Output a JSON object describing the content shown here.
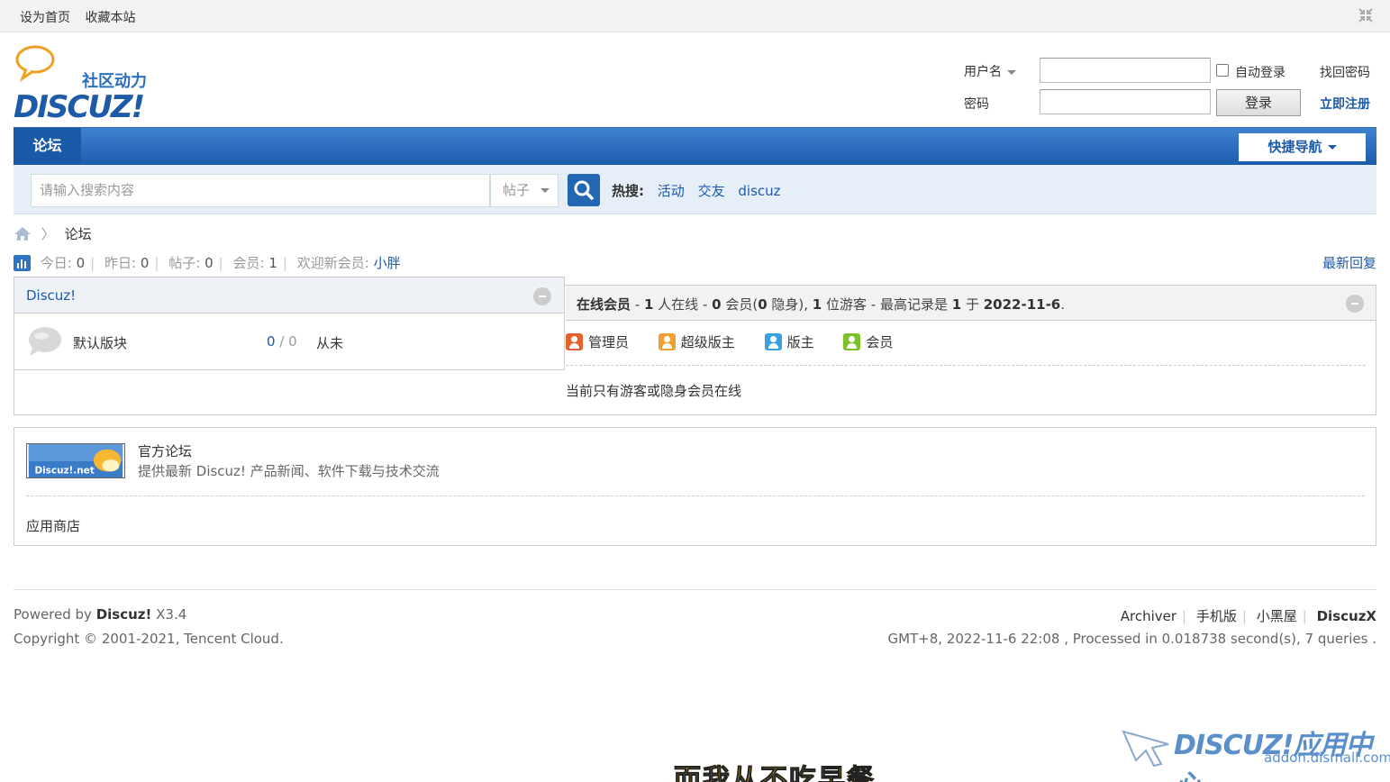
{
  "topbar": {
    "set_home": "设为首页",
    "bookmark": "收藏本站"
  },
  "logo": {
    "tagline": "社区动力",
    "brand": "DISCUZ!"
  },
  "login": {
    "username_label": "用户名",
    "password_label": "密码",
    "auto_login": "自动登录",
    "login_button": "登录",
    "forgot": "找回密码",
    "register": "立即注册"
  },
  "nav": {
    "forum_tab": "论坛",
    "quick_nav": "快捷导航"
  },
  "search": {
    "placeholder": "请输入搜索内容",
    "type": "帖子",
    "hot_label": "热搜:",
    "hot_terms": [
      "活动",
      "交友",
      "discuz"
    ]
  },
  "breadcrumb": {
    "current": "论坛"
  },
  "stats": {
    "today_label": "今日:",
    "today": "0",
    "yesterday_label": "昨日:",
    "yesterday": "0",
    "posts_label": "帖子:",
    "posts": "0",
    "members_label": "会员:",
    "members": "1",
    "welcome_label": "欢迎新会员:",
    "newest_member": "小胖",
    "latest_replies": "最新回复"
  },
  "forum_panel": {
    "title": "Discuz!",
    "forum_name": "默认版块",
    "threads": "0",
    "posts": "0",
    "last_post": "从未"
  },
  "online": {
    "title": "在线会员",
    "part1": " - ",
    "count_online": "1",
    "part2": " 人在线 - ",
    "count_members": "0",
    "part3": " 会员(",
    "count_hidden": "0",
    "part4": " 隐身), ",
    "count_guests": "1",
    "part5": " 位游客 - 最高记录是 ",
    "record": "1",
    "part6": " 于 ",
    "record_date": "2022-11-6",
    "part7": ".",
    "legend": [
      {
        "label": "管理员",
        "color": "#e8602c"
      },
      {
        "label": "超级版主",
        "color": "#f0a030"
      },
      {
        "label": "版主",
        "color": "#3aa0e0"
      },
      {
        "label": "会员",
        "color": "#7cc02a"
      }
    ],
    "empty_msg": "当前只有游客或隐身会员在线"
  },
  "links": {
    "banner_text": "Discuz!.net",
    "title": "官方论坛",
    "desc": "提供最新 Discuz! 产品新闻、软件下载与技术交流",
    "store": "应用商店"
  },
  "footer": {
    "powered_by": "Powered by ",
    "product": "Discuz!",
    "version": " X3.4",
    "copyright": "Copyright © 2001-2021, Tencent Cloud.",
    "links": [
      "Archiver",
      "手机版",
      "小黑屋"
    ],
    "discuzx": "DiscuzX",
    "stats_line": "GMT+8, 2022-11-6 22:08 , Processed in 0.018738 second(s), 7 queries ."
  },
  "watermark": {
    "brand": "DISCUZ!应用中心",
    "url": "addon.dismall.com"
  },
  "subtitle": "而我从不吃早餐"
}
